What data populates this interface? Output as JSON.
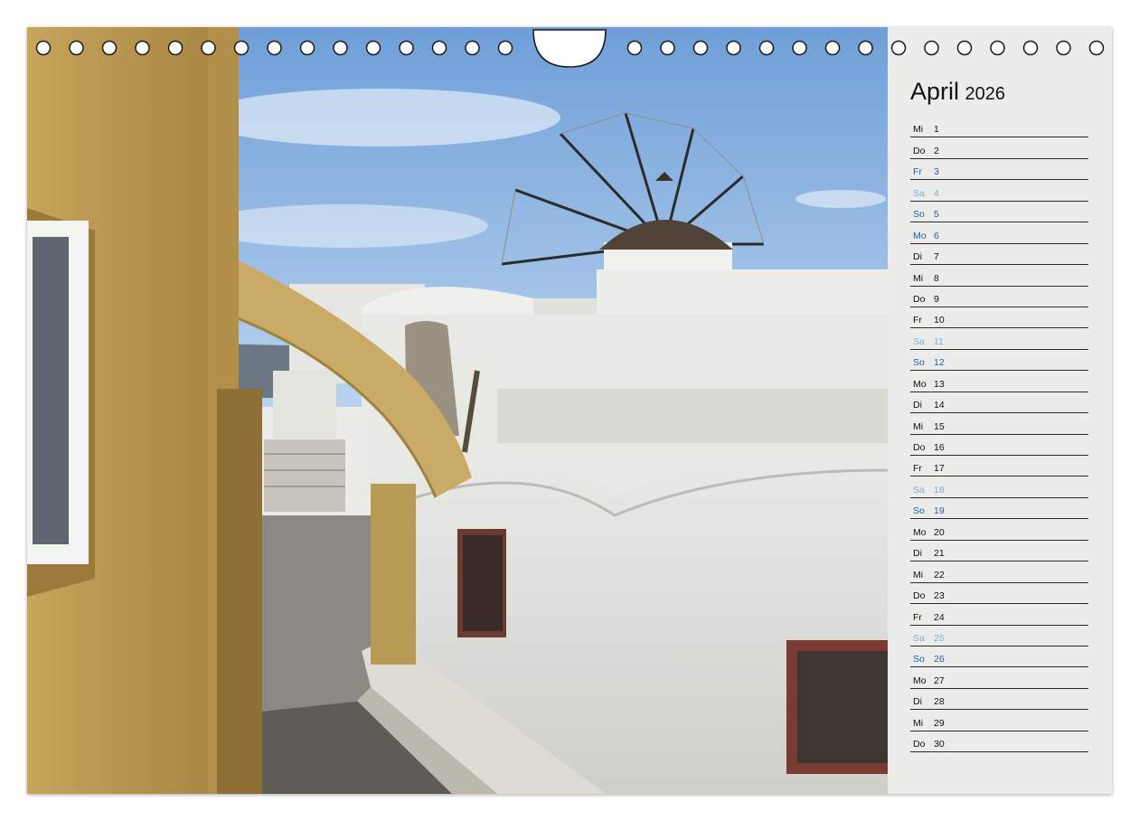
{
  "calendar": {
    "month": "April",
    "year": "2026",
    "days": [
      {
        "wd": "Mi",
        "d": "1",
        "type": "weekday"
      },
      {
        "wd": "Do",
        "d": "2",
        "type": "weekday"
      },
      {
        "wd": "Fr",
        "d": "3",
        "type": "sun"
      },
      {
        "wd": "Sa",
        "d": "4",
        "type": "sat"
      },
      {
        "wd": "So",
        "d": "5",
        "type": "sun"
      },
      {
        "wd": "Mo",
        "d": "6",
        "type": "sun"
      },
      {
        "wd": "Di",
        "d": "7",
        "type": "weekday"
      },
      {
        "wd": "Mi",
        "d": "8",
        "type": "weekday"
      },
      {
        "wd": "Do",
        "d": "9",
        "type": "weekday"
      },
      {
        "wd": "Fr",
        "d": "10",
        "type": "weekday"
      },
      {
        "wd": "Sa",
        "d": "11",
        "type": "sat"
      },
      {
        "wd": "So",
        "d": "12",
        "type": "sun"
      },
      {
        "wd": "Mo",
        "d": "13",
        "type": "weekday"
      },
      {
        "wd": "Di",
        "d": "14",
        "type": "weekday"
      },
      {
        "wd": "Mi",
        "d": "15",
        "type": "weekday"
      },
      {
        "wd": "Do",
        "d": "16",
        "type": "weekday"
      },
      {
        "wd": "Fr",
        "d": "17",
        "type": "weekday"
      },
      {
        "wd": "Sa",
        "d": "18",
        "type": "sat"
      },
      {
        "wd": "So",
        "d": "19",
        "type": "sun"
      },
      {
        "wd": "Mo",
        "d": "20",
        "type": "weekday"
      },
      {
        "wd": "Di",
        "d": "21",
        "type": "weekday"
      },
      {
        "wd": "Mi",
        "d": "22",
        "type": "weekday"
      },
      {
        "wd": "Do",
        "d": "23",
        "type": "weekday"
      },
      {
        "wd": "Fr",
        "d": "24",
        "type": "weekday"
      },
      {
        "wd": "Sa",
        "d": "25",
        "type": "sat"
      },
      {
        "wd": "So",
        "d": "26",
        "type": "sun"
      },
      {
        "wd": "Mo",
        "d": "27",
        "type": "weekday"
      },
      {
        "wd": "Di",
        "d": "28",
        "type": "weekday"
      },
      {
        "wd": "Mi",
        "d": "29",
        "type": "weekday"
      },
      {
        "wd": "Do",
        "d": "30",
        "type": "weekday"
      }
    ]
  },
  "colors": {
    "saturday": "#7aaed2",
    "sunday_holiday": "#1c5ea3",
    "panel": "#ececea"
  },
  "photo": {
    "icon": "santorini-windmill-photo"
  }
}
